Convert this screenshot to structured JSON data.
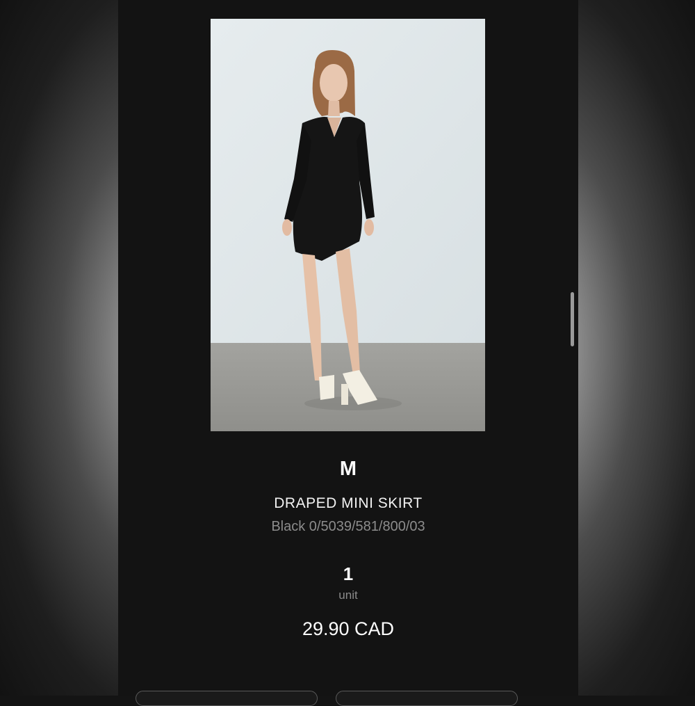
{
  "product": {
    "image_alt": "Model wearing black draped mini dress with white platform heels",
    "size": "M",
    "name": "DRAPED MINI SKIRT",
    "reference": "Black  0/5039/581/800/03",
    "quantity": "1",
    "quantity_unit": "unit",
    "price": "29.90 CAD"
  },
  "colors": {
    "screen_background": "#131313",
    "primary_text": "#ffffff",
    "secondary_text": "#8c8c8c"
  }
}
